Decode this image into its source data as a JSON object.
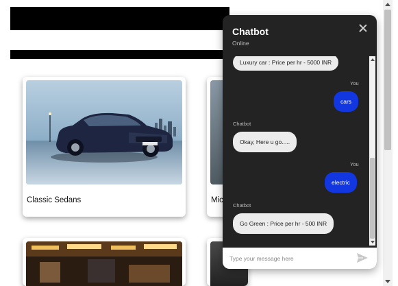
{
  "cards": [
    {
      "title": "Classic Sedans"
    },
    {
      "title": "Mic"
    }
  ],
  "chat": {
    "title": "Chatbot",
    "status": "Online",
    "input_placeholder": "Type your message here",
    "messages": [
      {
        "sender": "",
        "text": "Luxury car : Price per hr - 5000 INR"
      },
      {
        "sender": "You",
        "text": "cars"
      },
      {
        "sender": "Chatbot",
        "text": "Okay, Here u go....."
      },
      {
        "sender": "You",
        "text": "electric"
      },
      {
        "sender": "Chatbot",
        "text": "Go Green : Price per hr - 500 INR"
      }
    ]
  },
  "colors": {
    "chat_bg": "#232323",
    "user_bubble": "#1237e0",
    "bot_bubble": "#ececec"
  },
  "icons": {
    "close": "close-icon",
    "send": "send-icon"
  }
}
